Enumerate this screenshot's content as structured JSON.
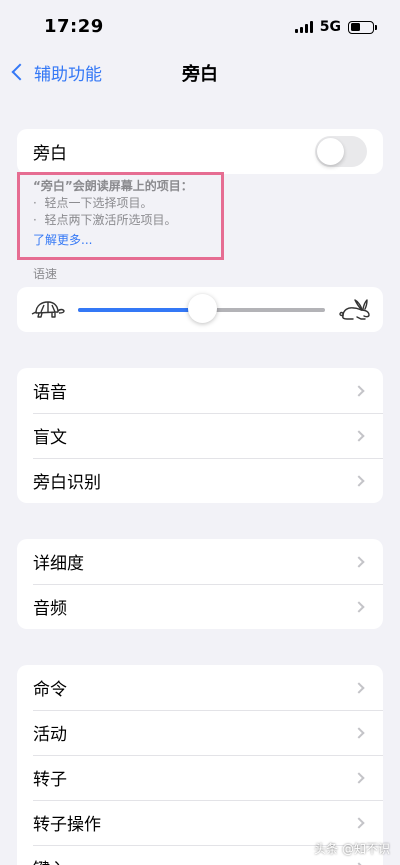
{
  "status_bar": {
    "time": "17:29",
    "network": "5G",
    "battery_level": 0.45
  },
  "nav": {
    "back_label": "辅助功能",
    "title": "旁白"
  },
  "voiceover_toggle": {
    "label": "旁白",
    "on": false
  },
  "footer": {
    "title": "“旁白”会朗读屏幕上的项目：",
    "bullets": [
      "轻点一下选择项目。",
      "轻点两下激活所选项目。"
    ],
    "bullet_mark": "·",
    "link": "了解更多..."
  },
  "speech_rate": {
    "section_label": "语速",
    "value": 0.5,
    "slow_icon": "turtle-icon",
    "fast_icon": "rabbit-icon"
  },
  "group_speech": {
    "items": [
      {
        "label": "语音"
      },
      {
        "label": "盲文"
      },
      {
        "label": "旁白识别"
      }
    ]
  },
  "group_verbosity": {
    "items": [
      {
        "label": "详细度"
      },
      {
        "label": "音频"
      }
    ]
  },
  "group_commands": {
    "items": [
      {
        "label": "命令"
      },
      {
        "label": "活动"
      },
      {
        "label": "转子"
      },
      {
        "label": "转子操作"
      },
      {
        "label": "键入"
      }
    ]
  },
  "watermark": {
    "text": "头条 @知不识"
  },
  "colors": {
    "accent": "#3478f6",
    "background": "#f2f2f7",
    "highlight_border": "#e66d92"
  }
}
